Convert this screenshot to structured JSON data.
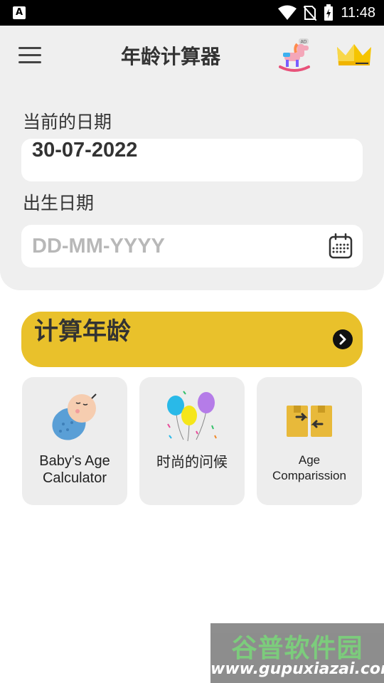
{
  "status_bar": {
    "time": "11:48",
    "notification_icon": "A"
  },
  "header": {
    "title": "年龄计算器"
  },
  "current_date": {
    "label": "当前的日期",
    "value": "30-07-2022"
  },
  "birth_date": {
    "label": "出生日期",
    "placeholder": "DD-MM-YYYY",
    "value": ""
  },
  "calculate": {
    "label": "计算年龄"
  },
  "cards": [
    {
      "line1": "Baby's Age",
      "line2": "Calculator"
    },
    {
      "line1": "时尚的问候",
      "line2": ""
    },
    {
      "line1": "Age",
      "line2": "Comparission"
    }
  ],
  "watermark": {
    "brand": "谷普软件园",
    "url": "www.gupuxiazai.com"
  },
  "colors": {
    "accent": "#e9c12b",
    "panel": "#efefef",
    "card": "#ededed",
    "text": "#333333"
  },
  "icons": [
    "menu-icon",
    "rocking-horse-icon",
    "crown-icon",
    "calendar-icon",
    "arrow-right-icon",
    "baby-icon",
    "balloons-icon",
    "compare-boxes-icon"
  ]
}
